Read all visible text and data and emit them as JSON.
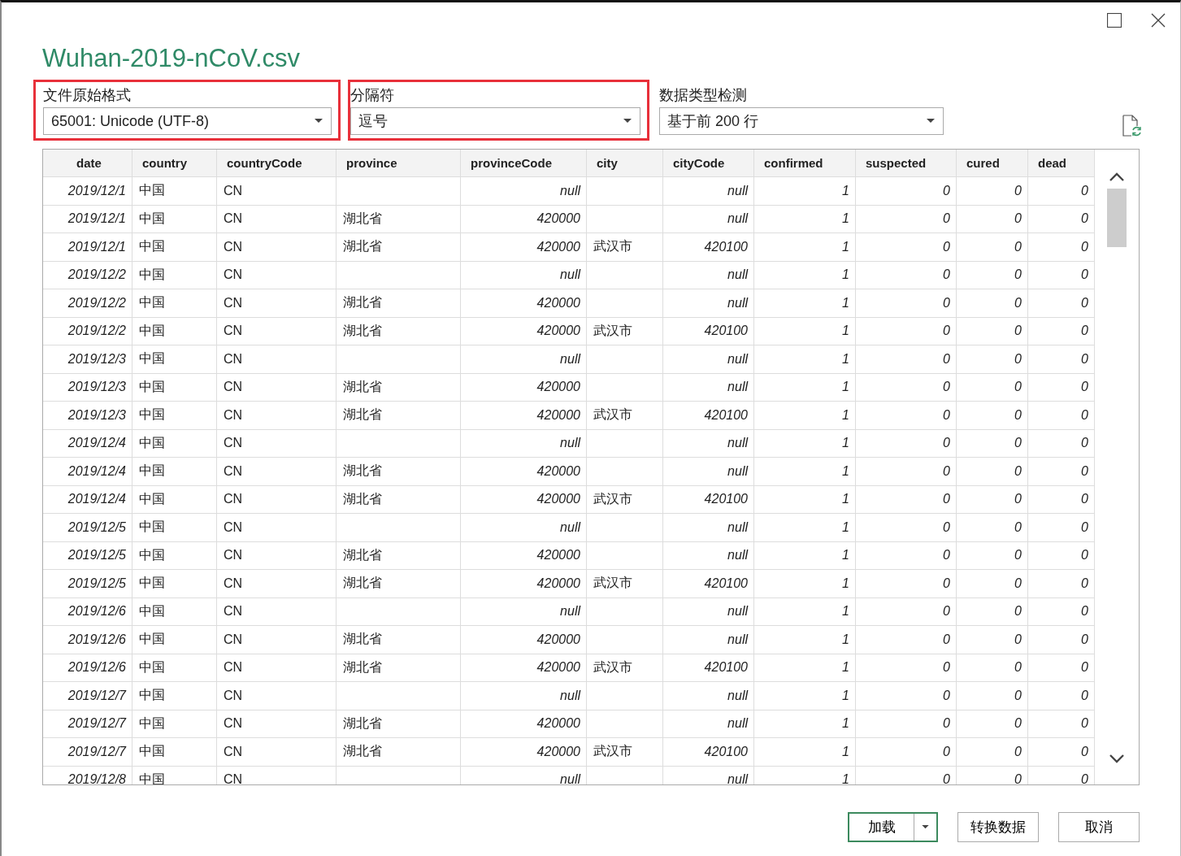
{
  "window": {
    "title": "Wuhan-2019-nCoV.csv"
  },
  "options": [
    {
      "label": "文件原始格式",
      "value": "65001: Unicode (UTF-8)",
      "highlighted": true
    },
    {
      "label": "分隔符",
      "value": "逗号",
      "highlighted": true
    },
    {
      "label": "数据类型检测",
      "value": "基于前 200 行",
      "highlighted": false
    }
  ],
  "table": {
    "columns": [
      {
        "label": "date",
        "kind": "date"
      },
      {
        "label": "country",
        "kind": "text"
      },
      {
        "label": "countryCode",
        "kind": "text"
      },
      {
        "label": "province",
        "kind": "text"
      },
      {
        "label": "provinceCode",
        "kind": "number"
      },
      {
        "label": "city",
        "kind": "text"
      },
      {
        "label": "cityCode",
        "kind": "number"
      },
      {
        "label": "confirmed",
        "kind": "number"
      },
      {
        "label": "suspected",
        "kind": "number"
      },
      {
        "label": "cured",
        "kind": "number"
      },
      {
        "label": "dead",
        "kind": "number"
      }
    ],
    "rows": [
      [
        "2019/12/1",
        "中国",
        "CN",
        null,
        "null",
        null,
        "null",
        "1",
        "0",
        "0",
        "0"
      ],
      [
        "2019/12/1",
        "中国",
        "CN",
        "湖北省",
        "420000",
        null,
        "null",
        "1",
        "0",
        "0",
        "0"
      ],
      [
        "2019/12/1",
        "中国",
        "CN",
        "湖北省",
        "420000",
        "武汉市",
        "420100",
        "1",
        "0",
        "0",
        "0"
      ],
      [
        "2019/12/2",
        "中国",
        "CN",
        null,
        "null",
        null,
        "null",
        "1",
        "0",
        "0",
        "0"
      ],
      [
        "2019/12/2",
        "中国",
        "CN",
        "湖北省",
        "420000",
        null,
        "null",
        "1",
        "0",
        "0",
        "0"
      ],
      [
        "2019/12/2",
        "中国",
        "CN",
        "湖北省",
        "420000",
        "武汉市",
        "420100",
        "1",
        "0",
        "0",
        "0"
      ],
      [
        "2019/12/3",
        "中国",
        "CN",
        null,
        "null",
        null,
        "null",
        "1",
        "0",
        "0",
        "0"
      ],
      [
        "2019/12/3",
        "中国",
        "CN",
        "湖北省",
        "420000",
        null,
        "null",
        "1",
        "0",
        "0",
        "0"
      ],
      [
        "2019/12/3",
        "中国",
        "CN",
        "湖北省",
        "420000",
        "武汉市",
        "420100",
        "1",
        "0",
        "0",
        "0"
      ],
      [
        "2019/12/4",
        "中国",
        "CN",
        null,
        "null",
        null,
        "null",
        "1",
        "0",
        "0",
        "0"
      ],
      [
        "2019/12/4",
        "中国",
        "CN",
        "湖北省",
        "420000",
        null,
        "null",
        "1",
        "0",
        "0",
        "0"
      ],
      [
        "2019/12/4",
        "中国",
        "CN",
        "湖北省",
        "420000",
        "武汉市",
        "420100",
        "1",
        "0",
        "0",
        "0"
      ],
      [
        "2019/12/5",
        "中国",
        "CN",
        null,
        "null",
        null,
        "null",
        "1",
        "0",
        "0",
        "0"
      ],
      [
        "2019/12/5",
        "中国",
        "CN",
        "湖北省",
        "420000",
        null,
        "null",
        "1",
        "0",
        "0",
        "0"
      ],
      [
        "2019/12/5",
        "中国",
        "CN",
        "湖北省",
        "420000",
        "武汉市",
        "420100",
        "1",
        "0",
        "0",
        "0"
      ],
      [
        "2019/12/6",
        "中国",
        "CN",
        null,
        "null",
        null,
        "null",
        "1",
        "0",
        "0",
        "0"
      ],
      [
        "2019/12/6",
        "中国",
        "CN",
        "湖北省",
        "420000",
        null,
        "null",
        "1",
        "0",
        "0",
        "0"
      ],
      [
        "2019/12/6",
        "中国",
        "CN",
        "湖北省",
        "420000",
        "武汉市",
        "420100",
        "1",
        "0",
        "0",
        "0"
      ],
      [
        "2019/12/7",
        "中国",
        "CN",
        null,
        "null",
        null,
        "null",
        "1",
        "0",
        "0",
        "0"
      ],
      [
        "2019/12/7",
        "中国",
        "CN",
        "湖北省",
        "420000",
        null,
        "null",
        "1",
        "0",
        "0",
        "0"
      ],
      [
        "2019/12/7",
        "中国",
        "CN",
        "湖北省",
        "420000",
        "武汉市",
        "420100",
        "1",
        "0",
        "0",
        "0"
      ],
      [
        "2019/12/8",
        "中国",
        "CN",
        null,
        "null",
        null,
        "null",
        "1",
        "0",
        "0",
        "0"
      ]
    ]
  },
  "buttons": [
    {
      "label": "加载",
      "kind": "split",
      "default": true
    },
    {
      "label": "转换数据",
      "kind": "plain",
      "default": false
    },
    {
      "label": "取消",
      "kind": "plain",
      "default": false
    }
  ]
}
